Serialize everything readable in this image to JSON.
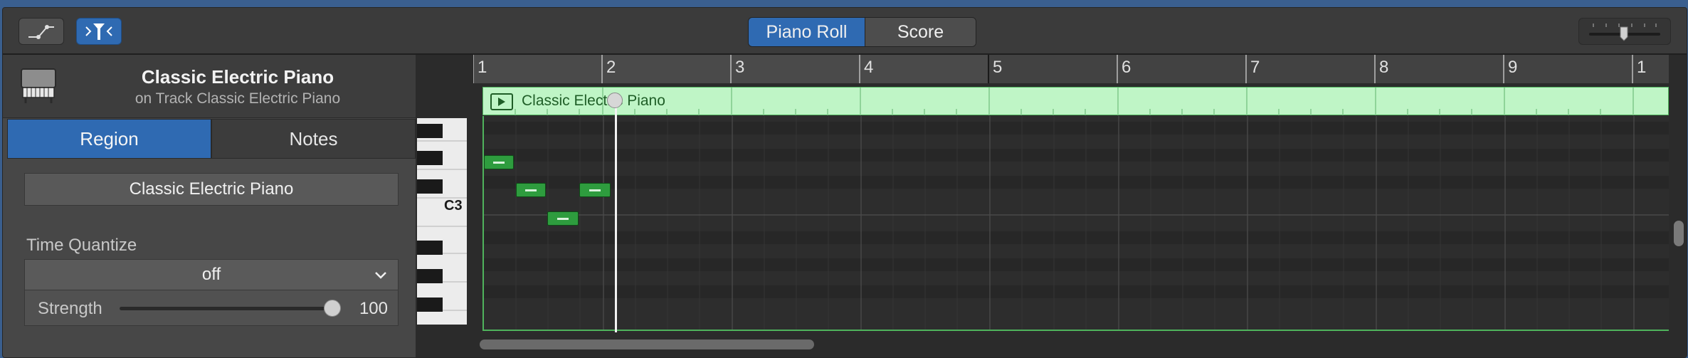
{
  "toolbar": {
    "view_tabs": [
      {
        "label": "Piano Roll",
        "selected": true
      },
      {
        "label": "Score",
        "selected": false
      }
    ]
  },
  "inspector": {
    "instrument_name": "Classic Electric Piano",
    "track_line": "on Track Classic Electric Piano",
    "tabs": [
      {
        "label": "Region",
        "selected": true
      },
      {
        "label": "Notes",
        "selected": false
      }
    ],
    "region_name": "Classic Electric Piano",
    "time_quantize": {
      "label": "Time Quantize",
      "value": "off"
    },
    "strength": {
      "label": "Strength",
      "value": "100"
    }
  },
  "editor": {
    "bar_numbers": [
      "1",
      "2",
      "3",
      "4",
      "5",
      "6",
      "7",
      "8",
      "9",
      "1"
    ],
    "region_title": "Classic Electric Piano",
    "pitch_label": "C3"
  },
  "colors": {
    "accent_blue": "#2f6ab2",
    "region_green": "#bff5c6",
    "note_green": "#2e9c3e"
  }
}
